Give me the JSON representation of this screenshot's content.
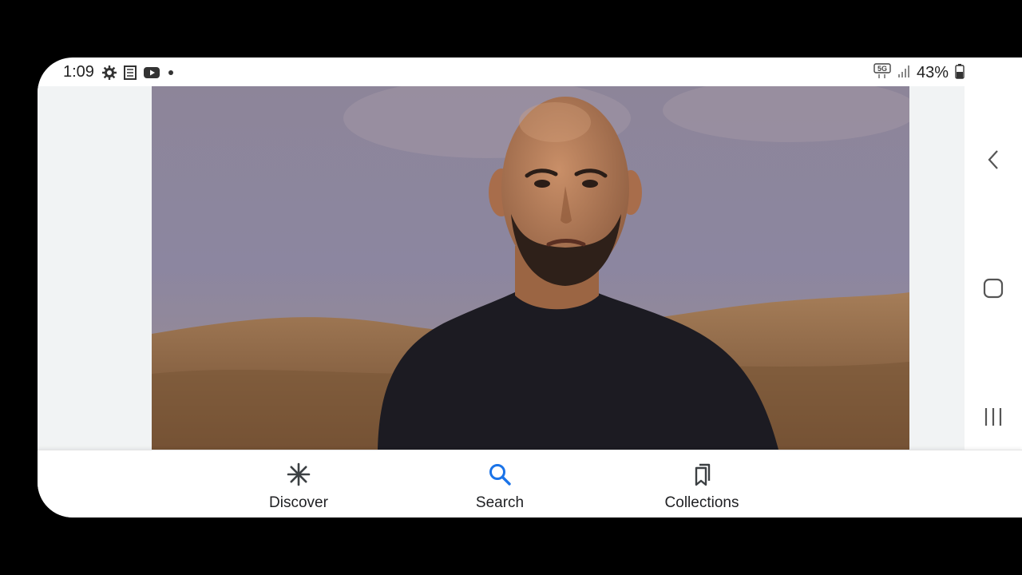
{
  "status_bar": {
    "time": "1:09",
    "battery_percent": "43%",
    "network": "5G",
    "icons": [
      "settings-icon",
      "news-icon",
      "youtube-icon",
      "dot-icon",
      "5g-icon",
      "signal-icon",
      "battery-icon"
    ]
  },
  "bottom_nav": {
    "items": [
      {
        "label": "Discover",
        "icon": "discover-icon"
      },
      {
        "label": "Search",
        "icon": "search-icon",
        "active": true
      },
      {
        "label": "Collections",
        "icon": "collections-icon"
      }
    ]
  },
  "system_nav": {
    "buttons": [
      "back-icon",
      "home-icon",
      "recents-icon"
    ]
  },
  "colors": {
    "accent": "#1a73e8",
    "text": "#202124",
    "content_bg": "#f1f3f4"
  }
}
